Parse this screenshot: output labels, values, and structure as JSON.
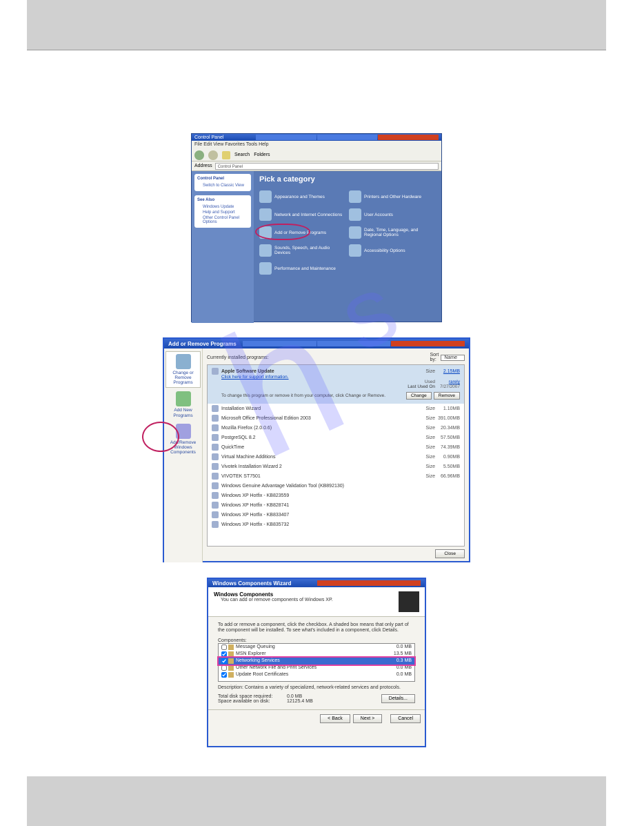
{
  "cp": {
    "title": "Control Panel",
    "menu": "File   Edit   View   Favorites   Tools   Help",
    "address_label": "Address",
    "address_value": "Control Panel",
    "toolbar": {
      "search": "Search",
      "folders": "Folders"
    },
    "side": {
      "box1_title": "Control Panel",
      "box1_link": "Switch to Classic View",
      "box2_title": "See Also",
      "box2_link1": "Windows Update",
      "box2_link2": "Help and Support",
      "box2_link3": "Other Control Panel Options"
    },
    "heading": "Pick a category",
    "cats": {
      "c1": "Appearance and Themes",
      "c2": "Printers and Other Hardware",
      "c3": "Network and Internet Connections",
      "c4": "User Accounts",
      "c5": "Add or Remove Programs",
      "c6": "Date, Time, Language, and Regional Options",
      "c7": "Sounds, Speech, and Audio Devices",
      "c8": "Accessibility Options",
      "c9": "Performance and Maintenance"
    }
  },
  "arp": {
    "title": "Add or Remove Programs",
    "side": {
      "i1": "Change or Remove Programs",
      "i2": "Add New Programs",
      "i3": "Add/Remove Windows Components"
    },
    "top_label": "Currently installed programs:",
    "sort_label": "Sort by:",
    "sort_value": "Name",
    "selected": {
      "name": "Apple Software Update",
      "support": "Click here for support information.",
      "size_label": "Size",
      "size_val": "2.15MB",
      "used_label": "Used",
      "used_val": "rarely",
      "last_label": "Last Used On",
      "last_val": "7/27/2007",
      "info": "To change this program or remove it from your computer, click Change or Remove.",
      "change_btn": "Change",
      "remove_btn": "Remove"
    },
    "rows": [
      {
        "name": "Installation Wizard",
        "size": "1.10MB"
      },
      {
        "name": "Microsoft Office Professional Edition 2003",
        "size": "391.00MB"
      },
      {
        "name": "Mozilla Firefox (2.0.0.6)",
        "size": "20.34MB"
      },
      {
        "name": "PostgreSQL 8.2",
        "size": "57.50MB"
      },
      {
        "name": "QuickTime",
        "size": "74.39MB"
      },
      {
        "name": "Virtual Machine Additions",
        "size": "0.90MB"
      },
      {
        "name": "Vivotek Installation Wizard 2",
        "size": "5.50MB"
      },
      {
        "name": "VIVOTEK ST7501",
        "size": "66.96MB"
      },
      {
        "name": "Windows Genuine Advantage Validation Tool (KB892130)",
        "size": ""
      },
      {
        "name": "Windows XP Hotfix - KB823559",
        "size": ""
      },
      {
        "name": "Windows XP Hotfix - KB828741",
        "size": ""
      },
      {
        "name": "Windows XP Hotfix - KB833407",
        "size": ""
      },
      {
        "name": "Windows XP Hotfix - KB835732",
        "size": ""
      }
    ],
    "size_col": "Size",
    "close_btn": "Close"
  },
  "wcw": {
    "title": "Windows Components Wizard",
    "hdr_title": "Windows Components",
    "hdr_sub": "You can add or remove components of Windows XP.",
    "instruction": "To add or remove a component, click the checkbox. A shaded box means that only part of the component will be installed. To see what's included in a component, click Details.",
    "components_label": "Components:",
    "rows": [
      {
        "checked": false,
        "name": "Message Queuing",
        "size": "0.0 MB"
      },
      {
        "checked": true,
        "name": "MSN Explorer",
        "size": "13.5 MB"
      },
      {
        "checked": true,
        "name": "Networking Services",
        "size": "0.3 MB"
      },
      {
        "checked": false,
        "name": "Other Network File and Print Services",
        "size": "0.0 MB"
      },
      {
        "checked": true,
        "name": "Update Root Certificates",
        "size": "0.0 MB"
      }
    ],
    "desc_label": "Description:",
    "desc_text": "Contains a variety of specialized, network-related services and protocols.",
    "space_req_label": "Total disk space required:",
    "space_req_val": "0.0 MB",
    "space_avail_label": "Space available on disk:",
    "space_avail_val": "12125.4 MB",
    "details_btn": "Details...",
    "back_btn": "< Back",
    "next_btn": "Next >",
    "cancel_btn": "Cancel"
  }
}
